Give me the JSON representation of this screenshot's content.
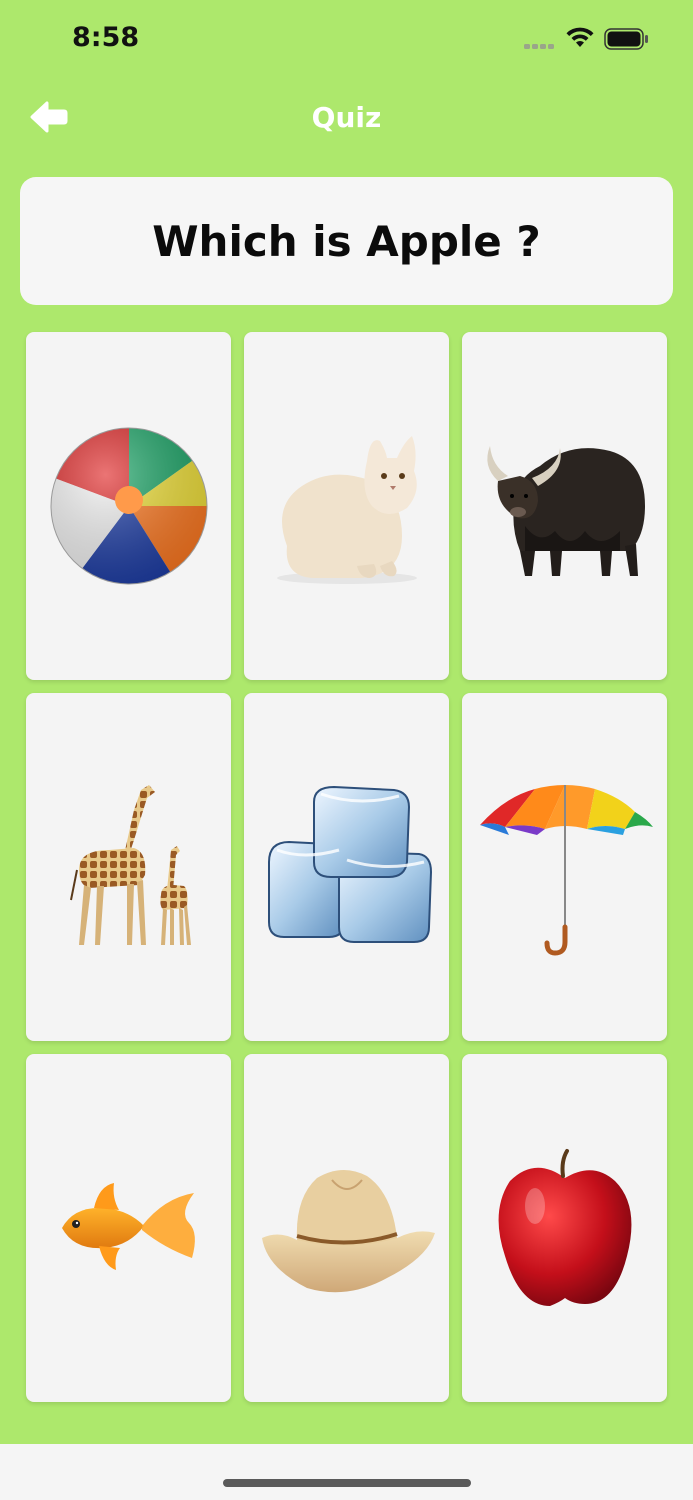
{
  "status_bar": {
    "time": "8:58"
  },
  "nav": {
    "title": "Quiz",
    "back_icon": "arrow-left-icon"
  },
  "question": {
    "text": "Which is Apple ?"
  },
  "options": [
    {
      "id": "ball",
      "icon": "beach-ball"
    },
    {
      "id": "cat",
      "icon": "cat"
    },
    {
      "id": "yak",
      "icon": "yak"
    },
    {
      "id": "giraffe",
      "icon": "giraffe"
    },
    {
      "id": "ice",
      "icon": "ice-cubes"
    },
    {
      "id": "umbrella",
      "icon": "umbrella"
    },
    {
      "id": "fish",
      "icon": "goldfish"
    },
    {
      "id": "hat",
      "icon": "straw-hat"
    },
    {
      "id": "apple",
      "icon": "apple"
    }
  ],
  "colors": {
    "background": "#ade86c",
    "card": "#f6f6f6",
    "title": "#ffffff"
  }
}
